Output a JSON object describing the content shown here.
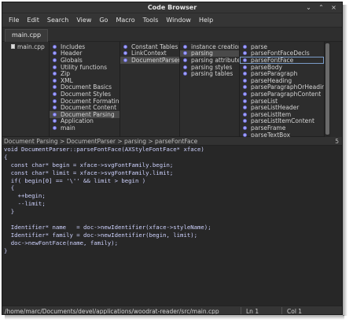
{
  "window": {
    "title": "Code Browser",
    "controls": {
      "minimize": "⌄",
      "maximize": "⌃",
      "close": "×"
    }
  },
  "menubar": [
    "File",
    "Edit",
    "Search",
    "View",
    "Go",
    "Macro",
    "Tools",
    "Window",
    "Help"
  ],
  "tabs": [
    {
      "label": "main.cpp",
      "active": true
    }
  ],
  "browser": {
    "files": [
      "main.cpp"
    ],
    "col2": [
      "Includes",
      "Header",
      "Globals",
      "Utility functions",
      "Zip",
      "XML",
      "Document Basics",
      "Document Styles",
      "Document Formating",
      "Document Content",
      "Document Parsing",
      "Application",
      "main"
    ],
    "col2_selected": "Document Parsing",
    "col3": [
      "Constant Tables",
      "LinkContext",
      "DocumentParser"
    ],
    "col3_selected": "DocumentParser",
    "col4": [
      "instance creation",
      "parsing",
      "parsing attributes",
      "parsing styles",
      "parsing tables"
    ],
    "col4_selected": "parsing",
    "col5": [
      "parse",
      "parseFontFaceDecls",
      "parseFontFace",
      "parseBody",
      "parseParagraph",
      "parseHeading",
      "parseParagraphOrHeading",
      "parseParagraphContent",
      "parseList",
      "parseListHeader",
      "parseListItem",
      "parseListItemContent",
      "parseFrame",
      "parseTextBox"
    ],
    "col5_selected": "parseFontFace"
  },
  "breadcrumb": {
    "path": "Document Parsing > DocumentParser > parsing > parseFontFace",
    "count": "5"
  },
  "editor": {
    "lines": [
      "void DocumentParser::parseFontFace(AXStyleFontFace* xface)",
      "{",
      "  const char* begin = xface->svgFontFamily.begin;",
      "  const char* limit = xface->svgFontFamily.limit;",
      "  if( begin[0] == '\\'' && limit > begin )",
      "  {",
      "    ++begin;",
      "    --limit;",
      "  }",
      "",
      "  Identifier* name   = doc->newIdentifier(xface->styleName);",
      "  Identifier* family = doc->newIdentifier(begin, limit);",
      "  doc->newFontFace(name, family);",
      "}"
    ]
  },
  "statusbar": {
    "path": "/home/marc/Documents/devel/applications/woodrat-reader/src/main.cpp",
    "line": "Ln 1",
    "col": "Col 1"
  }
}
